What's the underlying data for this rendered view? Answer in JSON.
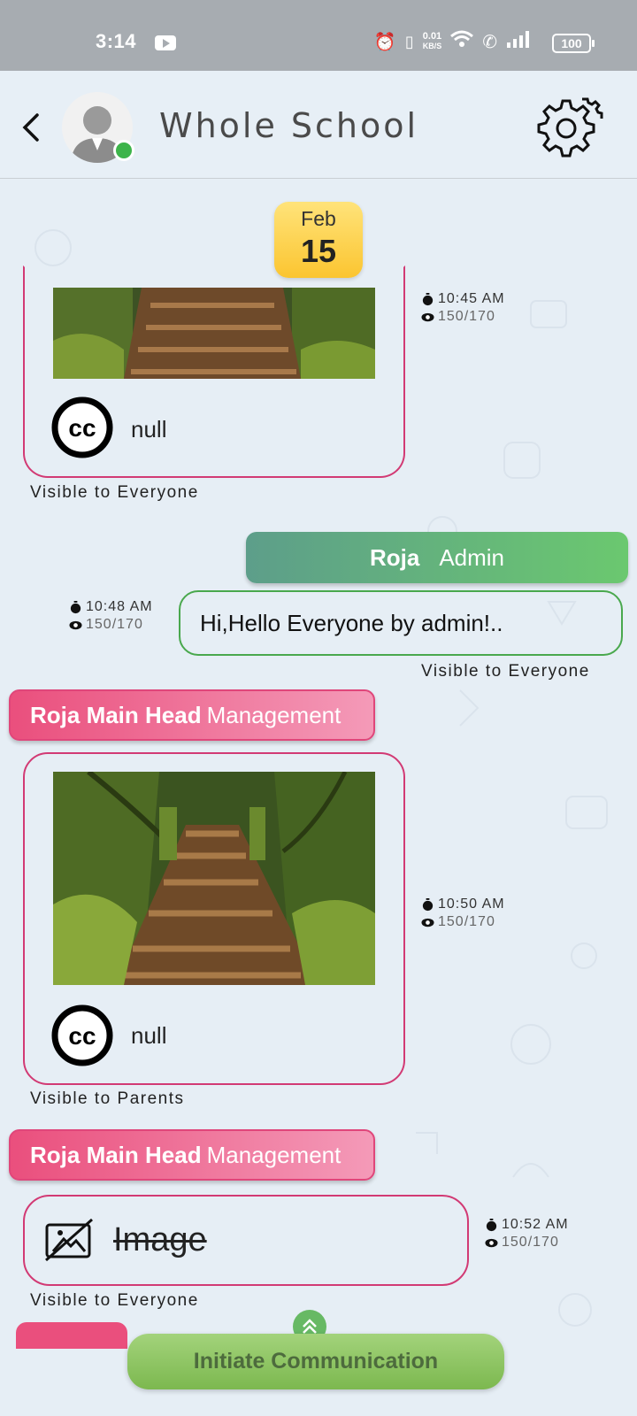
{
  "status_bar": {
    "time": "3:14",
    "speed_value": "0.01",
    "speed_unit": "KB/S",
    "battery": "100"
  },
  "header": {
    "title": "Whole School"
  },
  "date_badge": {
    "month": "Feb",
    "day": "15"
  },
  "messages": [
    {
      "type": "image",
      "caption": "null",
      "visibility": "Visible to Everyone",
      "time": "10:45 AM",
      "views": "150/170"
    },
    {
      "type": "text",
      "sender_name": "Roja",
      "sender_role": "Admin",
      "text": "Hi,Hello Everyone by admin!..",
      "visibility": "Visible to Everyone",
      "time": "10:48 AM",
      "views": "150/170"
    },
    {
      "type": "image",
      "sender_name": "Roja Main Head",
      "sender_role": "Management",
      "caption": "null",
      "visibility": "Visible to Parents",
      "time": "10:50 AM",
      "views": "150/170"
    },
    {
      "type": "image_removed",
      "sender_name": "Roja Main Head",
      "sender_role": "Management",
      "label": "Image",
      "visibility": "Visible to Everyone",
      "time": "10:52 AM",
      "views": "150/170"
    }
  ],
  "footer": {
    "initiate_label": "Initiate Communication"
  },
  "colors": {
    "card_border": "#d23a74",
    "text_border": "#49a84d",
    "accent_green": "#7cb84f",
    "date_badge": "#fbc530"
  },
  "icons": [
    "back-icon",
    "gear-icon",
    "cc-icon",
    "stopwatch-icon",
    "eye-icon",
    "image-off-icon",
    "chevron-up-icon"
  ]
}
